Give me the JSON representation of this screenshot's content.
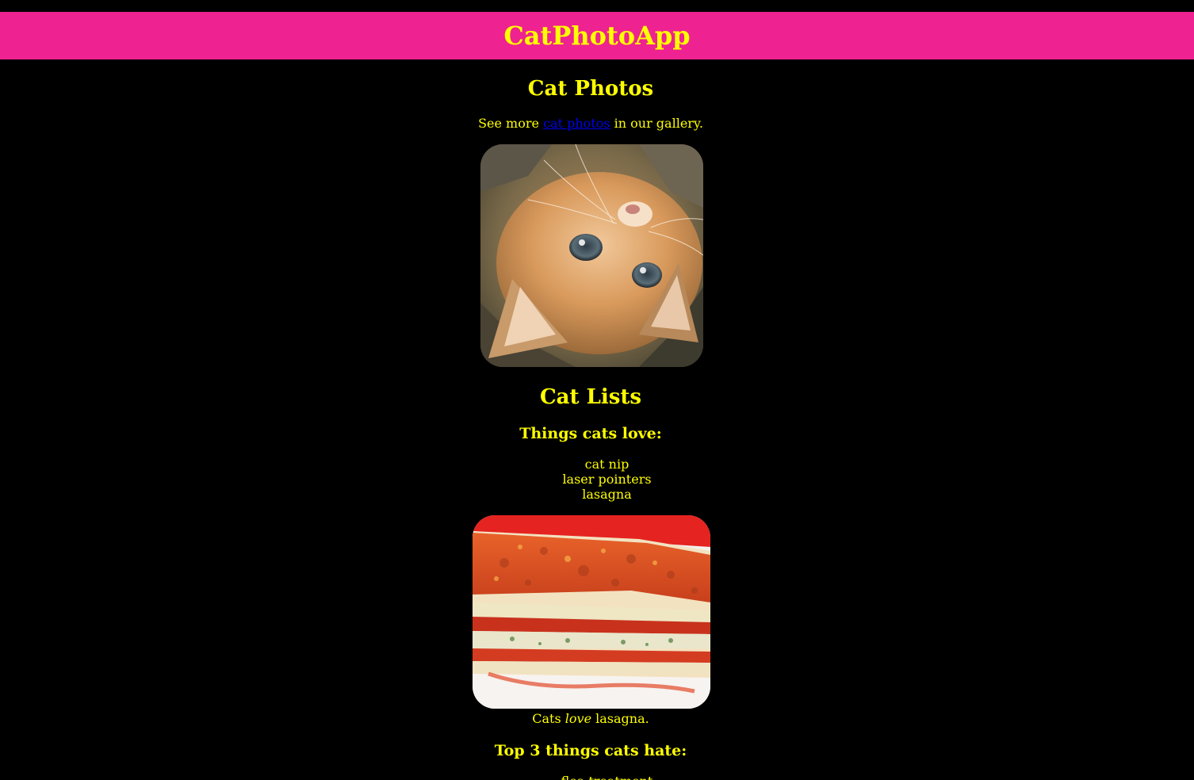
{
  "app": {
    "title": "CatPhotoApp"
  },
  "photos_section": {
    "heading": "Cat Photos",
    "text_before": "See more ",
    "link_text": "cat photos",
    "text_after": " in our gallery."
  },
  "lists_section": {
    "heading": "Cat Lists",
    "love_heading": "Things cats love:",
    "love_items": [
      "cat nip",
      "laser pointers",
      "lasagna"
    ],
    "caption_before": "Cats ",
    "caption_emphasis": "love",
    "caption_after": " lasagna.",
    "hate_heading": "Top 3 things cats hate:",
    "hate_first_item": "flea treatment"
  },
  "images": {
    "kitten_icon": "kitten-photo",
    "lasagna_icon": "lasagna-photo"
  },
  "colors": {
    "background": "#000000",
    "header": "#ee2290",
    "text": "#ffff00",
    "link": "#0000ee"
  }
}
